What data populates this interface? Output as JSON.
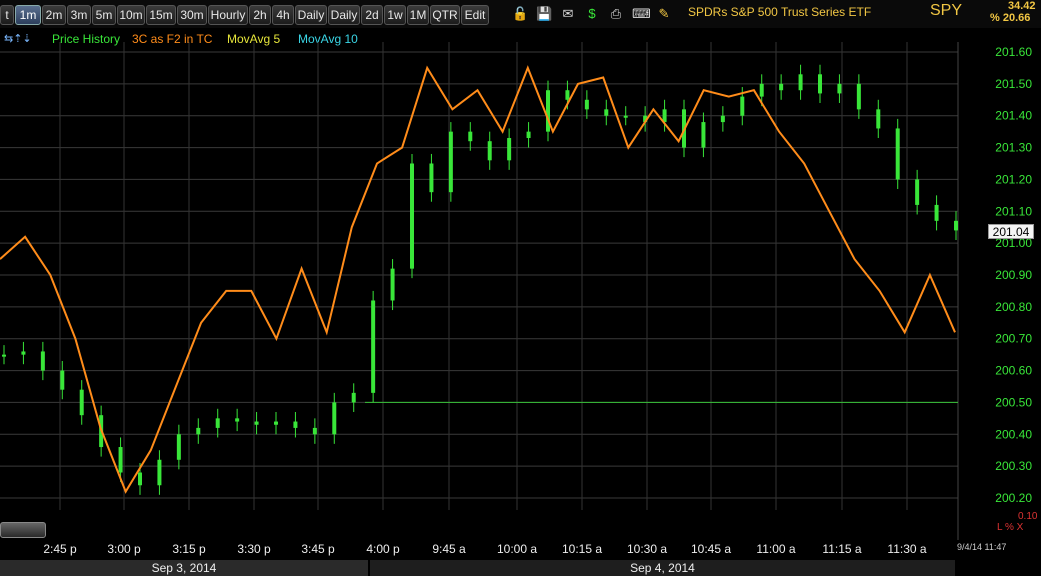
{
  "toolbar": {
    "tabs": [
      {
        "label": "t",
        "active": false
      },
      {
        "label": "1m",
        "active": true
      },
      {
        "label": "2m",
        "active": false
      },
      {
        "label": "3m",
        "active": false
      },
      {
        "label": "5m",
        "active": false
      },
      {
        "label": "10m",
        "active": false
      },
      {
        "label": "15m",
        "active": false
      },
      {
        "label": "30m",
        "active": false
      },
      {
        "label": "Hourly",
        "active": false
      },
      {
        "label": "2h",
        "active": false
      },
      {
        "label": "4h",
        "active": false
      },
      {
        "label": "Daily",
        "active": false
      },
      {
        "label": "Daily",
        "active": false
      },
      {
        "label": "2d",
        "active": false
      },
      {
        "label": "1w",
        "active": false
      },
      {
        "label": "1M",
        "active": false
      },
      {
        "label": "QTR",
        "active": false
      },
      {
        "label": "Edit",
        "active": false
      }
    ],
    "icons": [
      "lock-icon",
      "save-icon",
      "mail-icon",
      "dollar-icon",
      "print-icon",
      "keyboard-icon",
      "pencil-icon"
    ]
  },
  "header": {
    "title": "SPDRs S&P 500 Trust Series ETF",
    "symbol": "SPY",
    "change": "34.42",
    "change_pct": "% 20.66"
  },
  "legend": [
    {
      "label": "Price History",
      "color": "#39e639"
    },
    {
      "label": "3C as F2 in TC",
      "color": "#ff8c1a"
    },
    {
      "label": "MovAvg 5",
      "color": "#e6e63a"
    },
    {
      "label": "MovAvg 10",
      "color": "#3ad6e6"
    }
  ],
  "price_tag": "201.04",
  "dates": {
    "left": "Sep 3, 2014",
    "right": "Sep 4, 2014"
  },
  "corner": {
    "top": "0.10",
    "bottom": "L % X"
  },
  "timestamp": "9/4/14 11:47",
  "chart_data": {
    "type": "line",
    "title": "SPDRs S&P 500 Trust Series ETF",
    "y_ticks": [
      "201.60",
      "201.50",
      "201.40",
      "201.30",
      "201.20",
      "201.10",
      "201.00",
      "200.90",
      "200.80",
      "200.70",
      "200.60",
      "200.50",
      "200.40",
      "200.30",
      "200.20"
    ],
    "x_ticks": [
      "2:45 p",
      "3:00 p",
      "3:15 p",
      "3:30 p",
      "3:45 p",
      "4:00 p",
      "9:45 a",
      "10:00 a",
      "10:15 a",
      "10:30 a",
      "10:45 a",
      "11:00 a",
      "11:15 a",
      "11:30 a"
    ],
    "ylim": [
      200.2,
      201.6
    ],
    "grid": true,
    "reference_line": 200.5,
    "series": [
      {
        "name": "Price History",
        "color": "#39e639",
        "style": "candles",
        "values": [
          200.65,
          200.66,
          200.6,
          200.54,
          200.46,
          200.36,
          200.28,
          200.24,
          200.32,
          200.4,
          200.42,
          200.45,
          200.44,
          200.43,
          200.44,
          200.42,
          200.4,
          200.5,
          200.53,
          200.82,
          200.92,
          201.25,
          201.16,
          201.35,
          201.32,
          201.26,
          201.33,
          201.35,
          201.48,
          201.45,
          201.42,
          201.4,
          201.4,
          201.38,
          201.42,
          201.3,
          201.38,
          201.4,
          201.46,
          201.5,
          201.48,
          201.53,
          201.47,
          201.5,
          201.42,
          201.36,
          201.2,
          201.12,
          201.07,
          201.04
        ]
      },
      {
        "name": "3C as F2 in TC",
        "color": "#ff8c1a",
        "style": "line",
        "values": [
          200.95,
          201.02,
          200.9,
          200.7,
          200.42,
          200.22,
          200.35,
          200.55,
          200.75,
          200.85,
          200.85,
          200.7,
          200.92,
          200.72,
          201.05,
          201.25,
          201.3,
          201.55,
          201.42,
          201.48,
          201.35,
          201.55,
          201.35,
          201.5,
          201.52,
          201.3,
          201.42,
          201.32,
          201.48,
          201.46,
          201.48,
          201.35,
          201.25,
          201.1,
          200.95,
          200.85,
          200.72,
          200.9,
          200.72
        ]
      }
    ]
  }
}
